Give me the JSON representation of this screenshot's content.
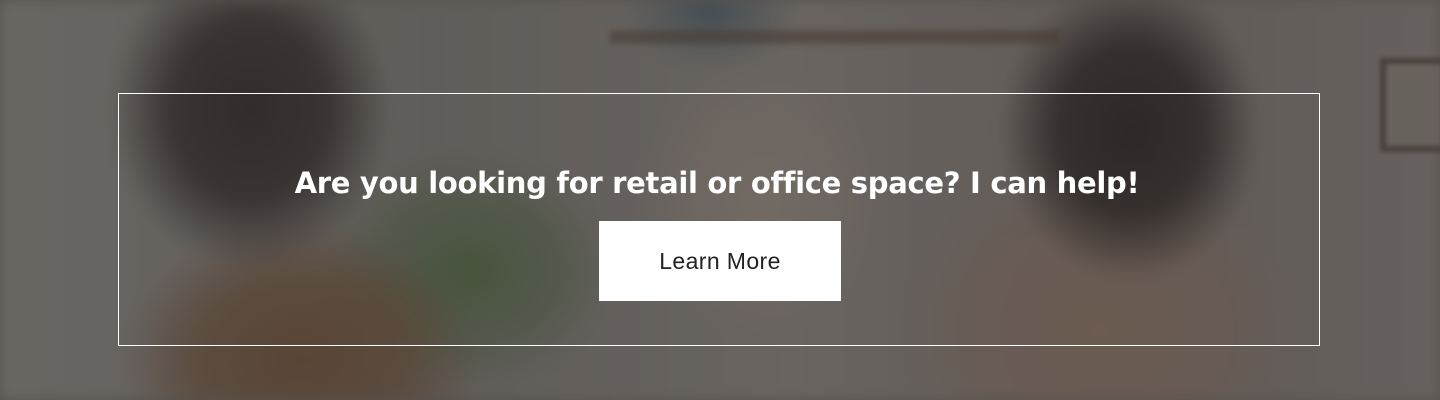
{
  "banner": {
    "headline": "Are you looking for retail or office space? I can help!",
    "cta_label": "Learn More"
  },
  "colors": {
    "text": "#ffffff",
    "button_background": "#ffffff",
    "button_text": "#222222",
    "frame_border": "#ffffff"
  }
}
